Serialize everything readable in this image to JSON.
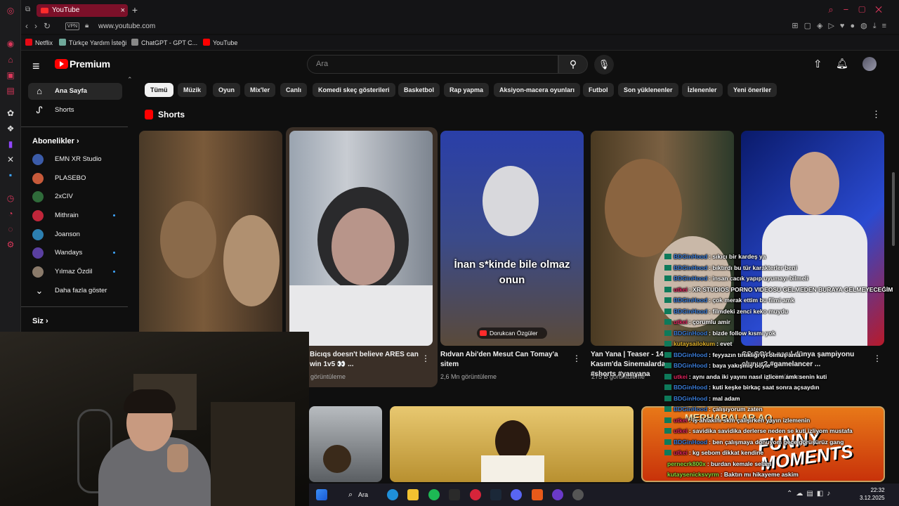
{
  "browser": {
    "tab_title": "YouTube",
    "tab_close": "×",
    "new_tab": "+",
    "vpn": "VPN",
    "url": "www.youtube.com",
    "bookmarks": [
      {
        "label": "Netflix",
        "color": "#e50914"
      },
      {
        "label": "Türkçe Yardım İsteği",
        "color": "#6fa89a"
      },
      {
        "label": "ChatGPT - GPT C...",
        "color": "#888888"
      },
      {
        "label": "YouTube",
        "color": "#ff0000"
      }
    ]
  },
  "header": {
    "logo_text": "Premium",
    "search_placeholder": "Ara"
  },
  "sidebar": {
    "items": [
      {
        "label": "Ana Sayfa",
        "icon": "home-icon"
      },
      {
        "label": "Shorts",
        "icon": "shorts-icon"
      }
    ],
    "subscriptions_title": "Abonelikler",
    "subscriptions": [
      {
        "label": "EMN XR Studio",
        "color": "#3b5ba8",
        "new": false
      },
      {
        "label": "PLASEBO",
        "color": "#c75a3a",
        "new": false
      },
      {
        "label": "2xCIV",
        "color": "#2f6b3a",
        "new": false
      },
      {
        "label": "Mithrain",
        "color": "#c0263a",
        "new": true
      },
      {
        "label": "Joanson",
        "color": "#2c7fb0",
        "new": false
      },
      {
        "label": "Wandays",
        "color": "#5a3fa0",
        "new": true
      },
      {
        "label": "Yılmaz Özdil",
        "color": "#8a7a6a",
        "new": true
      }
    ],
    "show_more": "Daha fazla göster",
    "you_title": "Siz"
  },
  "chips": [
    "Tümü",
    "Müzik",
    "Oyun",
    "Mix'ler",
    "Canlı",
    "Komedi skeç gösterileri",
    "Basketbol",
    "Rap yapma",
    "Aksiyon-macera oyunları",
    "Futbol",
    "Son yüklenenler",
    "İzlenenler",
    "Yeni öneriler"
  ],
  "shorts": {
    "title": "Shorts",
    "items": [
      {
        "title": "",
        "views": ""
      },
      {
        "title": "Bicıqs doesn't believe ARES can win 1v5 👀 ...",
        "views": "görüntüleme"
      },
      {
        "title": "Rıdvan Abi'den Mesut Can Tomay'a sitem",
        "views": "2,6 Mn görüntüleme",
        "caption": "İnan s*kinde bile olmaz onun",
        "channel_tag": "Dorukcan Özgüler"
      },
      {
        "title": "Yan Yana | Teaser - 14 Kasım'da Sinemalarda #shorts #yanyana",
        "views": "275 B görüntüleme"
      },
      {
        "title": "CS:GO'da nasıl dünya şampiyonu olunur? #gamelancer ...",
        "views": "görüntüleme"
      }
    ]
  },
  "bottom_row": {
    "overlay_text": "MERHABALAR AQ",
    "funny_text": "FUNNY MOMENTS"
  },
  "chat": [
    {
      "user": "BDGinHood",
      "msg": "sıkıcı bir kardeş ya",
      "color": "#3b7dd8"
    },
    {
      "user": "BDGinHood",
      "msg": "bıktırdı bu tür karakterler beni",
      "color": "#3b7dd8"
    },
    {
      "user": "BDGinHood",
      "msg": "insan cacık yapıp uyumayı bilmeli",
      "color": "#3b7dd8"
    },
    {
      "user": "utkei",
      "msg": "XR STUDIOS PORNO VIDEOSU GELMEDEN BURAYA GELMEYECEĞİM",
      "color": "#e0245e"
    },
    {
      "user": "BDGinHood",
      "msg": "çok merak ettim bu filmi amk",
      "color": "#3b7dd8"
    },
    {
      "user": "BDGinHood",
      "msg": "filmdeki zenci keko muydu",
      "color": "#3b7dd8"
    },
    {
      "user": "utkei",
      "msg": "çorumlu amir",
      "color": "#e0245e"
    },
    {
      "user": "BDGinHood",
      "msg": "bizde follow kısmı yok",
      "color": "#3b7dd8"
    },
    {
      "user": "kutaysailokum",
      "msg": "evet",
      "color": "#e4b32a"
    },
    {
      "user": "BDGinHood",
      "msg": "feyyazın tırtıklığı iyi olmuş ama",
      "color": "#3b7dd8"
    },
    {
      "user": "BDGinHood",
      "msg": "baya yakışmış böyle",
      "color": "#3b7dd8"
    },
    {
      "user": "utkei",
      "msg": "aynı anda iki yayını nasıl izlicem amk senin kuti",
      "color": "#e0245e"
    },
    {
      "user": "BDGinHood",
      "msg": "kuti keşke birkaç saat sonra açsaydın",
      "color": "#3b7dd8"
    },
    {
      "user": "BDGinHood",
      "msg": "mal adam",
      "color": "#3b7dd8"
    },
    {
      "user": "BDGinHood",
      "msg": "çalışıyorum zaten",
      "color": "#3b7dd8"
    },
    {
      "user": "utkei",
      "msg": "iş ahlakını skm çalışırken yayın izlemenin",
      "color": "#e0245e"
    },
    {
      "user": "utkei",
      "msg": "savidika savidika derlerse neden se kuti izliyom mustafa",
      "color": "#e0245e"
    },
    {
      "user": "BDGinHood",
      "msg": "ben çalışmaya donuyom gece görüşürüz gang",
      "color": "#3b7dd8"
    },
    {
      "user": "utkei",
      "msg": "kg sebom dikkat kendine",
      "color": "#e0245e"
    },
    {
      "user": "pernecrk800x",
      "msg": "burdan kemale selam",
      "color": "#8bdc3a"
    },
    {
      "user": "kutaysenicksvyrm",
      "msg": "Baktın mı hikayeme askim",
      "color": "#8bdc3a"
    }
  ],
  "taskbar": {
    "search_label": "Ara",
    "time": "22:32",
    "date": "3.12.2025"
  }
}
